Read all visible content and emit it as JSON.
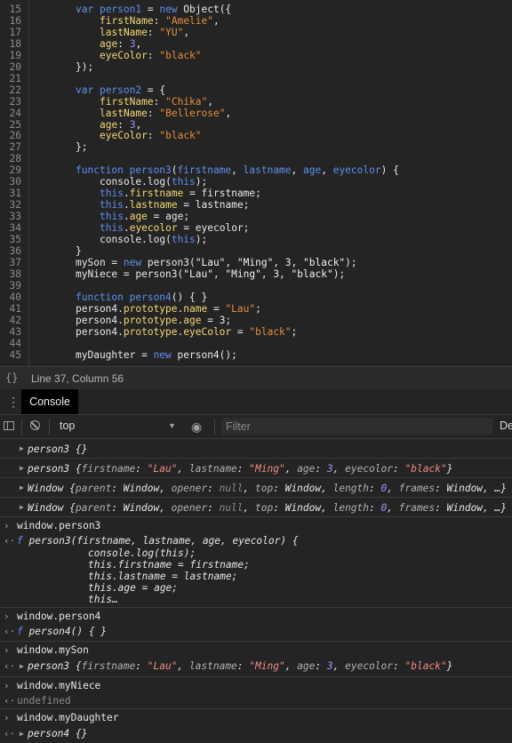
{
  "editor": {
    "lines": [
      {
        "n": "15",
        "segments": [
          {
            "t": "var ",
            "c": "kw"
          },
          {
            "t": "person1",
            "c": "kw"
          },
          {
            "t": " = ",
            "c": ""
          },
          {
            "t": "new ",
            "c": "kw"
          },
          {
            "t": "Object({",
            "c": ""
          }
        ],
        "indent": 0
      },
      {
        "n": "16",
        "segments": [
          {
            "t": "firstName",
            "c": "prop"
          },
          {
            "t": ": ",
            "c": ""
          },
          {
            "t": "\"Amelie\"",
            "c": "str"
          },
          {
            "t": ",",
            "c": ""
          }
        ],
        "indent": 1
      },
      {
        "n": "17",
        "segments": [
          {
            "t": "lastName",
            "c": "prop"
          },
          {
            "t": ": ",
            "c": ""
          },
          {
            "t": "\"YU\"",
            "c": "str"
          },
          {
            "t": ",",
            "c": ""
          }
        ],
        "indent": 1
      },
      {
        "n": "18",
        "segments": [
          {
            "t": "age",
            "c": "prop"
          },
          {
            "t": ": ",
            "c": ""
          },
          {
            "t": "3",
            "c": "num"
          },
          {
            "t": ",",
            "c": ""
          }
        ],
        "indent": 1
      },
      {
        "n": "19",
        "segments": [
          {
            "t": "eyeColor",
            "c": "prop"
          },
          {
            "t": ": ",
            "c": ""
          },
          {
            "t": "\"black\"",
            "c": "str"
          }
        ],
        "indent": 1
      },
      {
        "n": "20",
        "segments": [
          {
            "t": "});",
            "c": ""
          }
        ],
        "indent": 0
      },
      {
        "n": "21",
        "segments": [],
        "indent": 0
      },
      {
        "n": "22",
        "segments": [
          {
            "t": "var ",
            "c": "kw"
          },
          {
            "t": "person2",
            "c": "kw"
          },
          {
            "t": " = {",
            "c": ""
          }
        ],
        "indent": 0
      },
      {
        "n": "23",
        "segments": [
          {
            "t": "firstName",
            "c": "prop"
          },
          {
            "t": ": ",
            "c": ""
          },
          {
            "t": "\"Chika\"",
            "c": "str"
          },
          {
            "t": ",",
            "c": ""
          }
        ],
        "indent": 1
      },
      {
        "n": "24",
        "segments": [
          {
            "t": "lastName",
            "c": "prop"
          },
          {
            "t": ": ",
            "c": ""
          },
          {
            "t": "\"Bellerose\"",
            "c": "str"
          },
          {
            "t": ",",
            "c": ""
          }
        ],
        "indent": 1
      },
      {
        "n": "25",
        "segments": [
          {
            "t": "age",
            "c": "prop"
          },
          {
            "t": ": ",
            "c": ""
          },
          {
            "t": "3",
            "c": "num"
          },
          {
            "t": ",",
            "c": ""
          }
        ],
        "indent": 1
      },
      {
        "n": "26",
        "segments": [
          {
            "t": "eyeColor",
            "c": "prop"
          },
          {
            "t": ": ",
            "c": ""
          },
          {
            "t": "\"black\"",
            "c": "str"
          }
        ],
        "indent": 1
      },
      {
        "n": "27",
        "segments": [
          {
            "t": "};",
            "c": ""
          }
        ],
        "indent": 0
      },
      {
        "n": "28",
        "segments": [],
        "indent": 0
      },
      {
        "n": "29",
        "segments": [
          {
            "t": "function ",
            "c": "kw"
          },
          {
            "t": "person3",
            "c": "kw"
          },
          {
            "t": "(",
            "c": ""
          },
          {
            "t": "firstname",
            "c": "kw"
          },
          {
            "t": ", ",
            "c": ""
          },
          {
            "t": "lastname",
            "c": "kw"
          },
          {
            "t": ", ",
            "c": ""
          },
          {
            "t": "age",
            "c": "kw"
          },
          {
            "t": ", ",
            "c": ""
          },
          {
            "t": "eyecolor",
            "c": "kw"
          },
          {
            "t": ") {",
            "c": ""
          }
        ],
        "indent": 0
      },
      {
        "n": "30",
        "segments": [
          {
            "t": "console.log(",
            "c": ""
          },
          {
            "t": "this",
            "c": "kw"
          },
          {
            "t": ");",
            "c": ""
          }
        ],
        "indent": 1
      },
      {
        "n": "31",
        "segments": [
          {
            "t": "this",
            "c": "kw"
          },
          {
            "t": ".",
            "c": ""
          },
          {
            "t": "firstname",
            "c": "prop"
          },
          {
            "t": " = firstname;",
            "c": ""
          }
        ],
        "indent": 1
      },
      {
        "n": "32",
        "segments": [
          {
            "t": "this",
            "c": "kw"
          },
          {
            "t": ".",
            "c": ""
          },
          {
            "t": "lastname",
            "c": "prop"
          },
          {
            "t": " = lastname;",
            "c": ""
          }
        ],
        "indent": 1
      },
      {
        "n": "33",
        "segments": [
          {
            "t": "this",
            "c": "kw"
          },
          {
            "t": ".",
            "c": ""
          },
          {
            "t": "age",
            "c": "prop"
          },
          {
            "t": " = age;",
            "c": ""
          }
        ],
        "indent": 1
      },
      {
        "n": "34",
        "segments": [
          {
            "t": "this",
            "c": "kw"
          },
          {
            "t": ".",
            "c": ""
          },
          {
            "t": "eyecolor",
            "c": "prop"
          },
          {
            "t": " = eyecolor;",
            "c": ""
          }
        ],
        "indent": 1
      },
      {
        "n": "35",
        "segments": [
          {
            "t": "console.log(",
            "c": ""
          },
          {
            "t": "this",
            "c": "kw"
          },
          {
            "t": ");",
            "c": ""
          }
        ],
        "indent": 1
      },
      {
        "n": "36",
        "segments": [
          {
            "t": "}",
            "c": ""
          }
        ],
        "indent": 0
      },
      {
        "n": "37",
        "segments": [
          {
            "t": "mySon = ",
            "c": ""
          },
          {
            "t": "new ",
            "c": "kw"
          },
          {
            "t": "person3(",
            "c": ""
          },
          {
            "t": "\"Lau\"",
            "c": "str2"
          },
          {
            "t": ", ",
            "c": ""
          },
          {
            "t": "\"Ming\"",
            "c": "str2"
          },
          {
            "t": ", 3, ",
            "c": ""
          },
          {
            "t": "\"black\"",
            "c": "str2"
          },
          {
            "t": ");",
            "c": ""
          }
        ],
        "indent": 0
      },
      {
        "n": "38",
        "segments": [
          {
            "t": "myNiece = person3(",
            "c": ""
          },
          {
            "t": "\"Lau\"",
            "c": "str2"
          },
          {
            "t": ", ",
            "c": ""
          },
          {
            "t": "\"Ming\"",
            "c": "str2"
          },
          {
            "t": ", 3, ",
            "c": ""
          },
          {
            "t": "\"black\"",
            "c": "str2"
          },
          {
            "t": ");",
            "c": ""
          }
        ],
        "indent": 0
      },
      {
        "n": "39",
        "segments": [],
        "indent": 0
      },
      {
        "n": "40",
        "segments": [
          {
            "t": "function ",
            "c": "kw"
          },
          {
            "t": "person4",
            "c": "kw"
          },
          {
            "t": "() { }",
            "c": ""
          }
        ],
        "indent": 0
      },
      {
        "n": "41",
        "segments": [
          {
            "t": "person4.",
            "c": ""
          },
          {
            "t": "prototype",
            "c": "prop"
          },
          {
            "t": ".",
            "c": ""
          },
          {
            "t": "name",
            "c": "prop"
          },
          {
            "t": " = ",
            "c": ""
          },
          {
            "t": "\"Lau\"",
            "c": "str"
          },
          {
            "t": ";",
            "c": ""
          }
        ],
        "indent": 0
      },
      {
        "n": "42",
        "segments": [
          {
            "t": "person4.",
            "c": ""
          },
          {
            "t": "prototype",
            "c": "prop"
          },
          {
            "t": ".",
            "c": ""
          },
          {
            "t": "age",
            "c": "prop"
          },
          {
            "t": " = 3;",
            "c": ""
          }
        ],
        "indent": 0
      },
      {
        "n": "43",
        "segments": [
          {
            "t": "person4.",
            "c": ""
          },
          {
            "t": "prototype",
            "c": "prop"
          },
          {
            "t": ".",
            "c": ""
          },
          {
            "t": "eyeColor",
            "c": "prop"
          },
          {
            "t": " = ",
            "c": ""
          },
          {
            "t": "\"black\"",
            "c": "str"
          },
          {
            "t": ";",
            "c": ""
          }
        ],
        "indent": 0
      },
      {
        "n": "44",
        "segments": [],
        "indent": 0
      },
      {
        "n": "45",
        "segments": [
          {
            "t": "myDaughter = ",
            "c": ""
          },
          {
            "t": "new ",
            "c": "kw"
          },
          {
            "t": "person4();",
            "c": ""
          }
        ],
        "indent": 0
      }
    ]
  },
  "statusbar": {
    "braces": "{}",
    "position": "Line 37, Column 56"
  },
  "drawer": {
    "menu_icon": "⋮",
    "tab_label": "Console"
  },
  "toolbar": {
    "context": "top",
    "filter_placeholder": "Filter",
    "levels_label": "De"
  },
  "console": {
    "logs": [
      {
        "type": "object",
        "segments": [
          {
            "t": "person3 {}",
            "c": "it"
          }
        ]
      },
      {
        "type": "object",
        "segments": [
          {
            "t": "person3 {",
            "c": "it"
          },
          {
            "t": "firstname",
            "c": "key"
          },
          {
            "t": ": ",
            "c": "it"
          },
          {
            "t": "\"Lau\"",
            "c": "sv"
          },
          {
            "t": ", ",
            "c": "it"
          },
          {
            "t": "lastname",
            "c": "key"
          },
          {
            "t": ": ",
            "c": "it"
          },
          {
            "t": "\"Ming\"",
            "c": "sv"
          },
          {
            "t": ", ",
            "c": "it"
          },
          {
            "t": "age",
            "c": "key"
          },
          {
            "t": ": ",
            "c": "it"
          },
          {
            "t": "3",
            "c": "nv"
          },
          {
            "t": ", ",
            "c": "it"
          },
          {
            "t": "eyecolor",
            "c": "key"
          },
          {
            "t": ": ",
            "c": "it"
          },
          {
            "t": "\"black\"",
            "c": "sv"
          },
          {
            "t": "}",
            "c": "it"
          }
        ]
      },
      {
        "type": "object",
        "segments": [
          {
            "t": "Window {",
            "c": "it"
          },
          {
            "t": "parent",
            "c": "key"
          },
          {
            "t": ": Window, ",
            "c": "it"
          },
          {
            "t": "opener",
            "c": "key"
          },
          {
            "t": ": ",
            "c": "it"
          },
          {
            "t": "null",
            "c": "nul"
          },
          {
            "t": ", ",
            "c": "it"
          },
          {
            "t": "top",
            "c": "key"
          },
          {
            "t": ": Window, ",
            "c": "it"
          },
          {
            "t": "length",
            "c": "key"
          },
          {
            "t": ": ",
            "c": "it"
          },
          {
            "t": "0",
            "c": "nv"
          },
          {
            "t": ", ",
            "c": "it"
          },
          {
            "t": "frames",
            "c": "key"
          },
          {
            "t": ": Window, …}",
            "c": "it"
          }
        ]
      },
      {
        "type": "object",
        "segments": [
          {
            "t": "Window {",
            "c": "it"
          },
          {
            "t": "parent",
            "c": "key"
          },
          {
            "t": ": Window, ",
            "c": "it"
          },
          {
            "t": "opener",
            "c": "key"
          },
          {
            "t": ": ",
            "c": "it"
          },
          {
            "t": "null",
            "c": "nul"
          },
          {
            "t": ", ",
            "c": "it"
          },
          {
            "t": "top",
            "c": "key"
          },
          {
            "t": ": Window, ",
            "c": "it"
          },
          {
            "t": "length",
            "c": "key"
          },
          {
            "t": ": ",
            "c": "it"
          },
          {
            "t": "0",
            "c": "nv"
          },
          {
            "t": ", ",
            "c": "it"
          },
          {
            "t": "frames",
            "c": "key"
          },
          {
            "t": ": Window, …}",
            "c": "it"
          }
        ]
      }
    ],
    "input1": "window.person3",
    "fn_sig": {
      "f": "f",
      "rest": " person3(firstname, lastname, age, eyecolor) {"
    },
    "fn_body": [
      "console.log(this);",
      "this.firstname = firstname;",
      "this.lastname = lastname;",
      "this.age = age;",
      "this…"
    ],
    "input2": "window.person4",
    "result2": {
      "f": "f",
      "rest": " person4() { }"
    },
    "input3": "window.mySon",
    "result3": [
      {
        "t": "person3 {",
        "c": "it"
      },
      {
        "t": "firstname",
        "c": "key"
      },
      {
        "t": ": ",
        "c": "it"
      },
      {
        "t": "\"Lau\"",
        "c": "sv"
      },
      {
        "t": ", ",
        "c": "it"
      },
      {
        "t": "lastname",
        "c": "key"
      },
      {
        "t": ": ",
        "c": "it"
      },
      {
        "t": "\"Ming\"",
        "c": "sv"
      },
      {
        "t": ", ",
        "c": "it"
      },
      {
        "t": "age",
        "c": "key"
      },
      {
        "t": ": ",
        "c": "it"
      },
      {
        "t": "3",
        "c": "nv"
      },
      {
        "t": ", ",
        "c": "it"
      },
      {
        "t": "eyecolor",
        "c": "key"
      },
      {
        "t": ": ",
        "c": "it"
      },
      {
        "t": "\"black\"",
        "c": "sv"
      },
      {
        "t": "}",
        "c": "it"
      }
    ],
    "input4": "window.myNiece",
    "result4": "undefined",
    "input5": "window.myDaughter",
    "result5": "person4 {}",
    "prompt_glyph": "›",
    "result_glyph": "‹·",
    "expand_glyph": "▶"
  }
}
